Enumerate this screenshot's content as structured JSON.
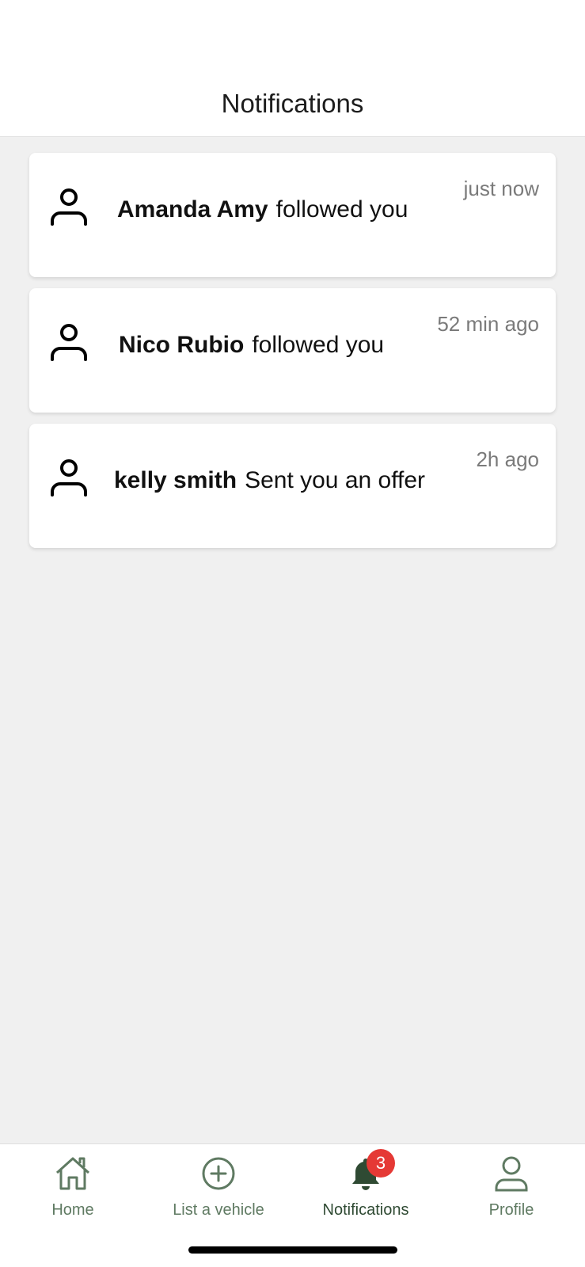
{
  "header": {
    "title": "Notifications"
  },
  "notifications": [
    {
      "name": "Amanda Amy",
      "action": "followed you",
      "time": "just now",
      "icon": "user-icon"
    },
    {
      "name": "Nico Rubio",
      "action": "followed you",
      "time": "52 min ago",
      "icon": "user-icon"
    },
    {
      "name": "kelly smith",
      "action": "Sent you an offer",
      "time": "2h ago",
      "icon": "user-icon"
    }
  ],
  "tabbar": {
    "tabs": [
      {
        "label": "Home",
        "icon": "home-icon"
      },
      {
        "label": "List a vehicle",
        "icon": "plus-circle-icon"
      },
      {
        "label": "Notifications",
        "icon": "bell-icon",
        "badge": "3",
        "active": true
      },
      {
        "label": "Profile",
        "icon": "user-icon"
      }
    ]
  },
  "colors": {
    "accent": "#5f7a62",
    "active": "#2f4a33",
    "badge": "#e53935"
  }
}
